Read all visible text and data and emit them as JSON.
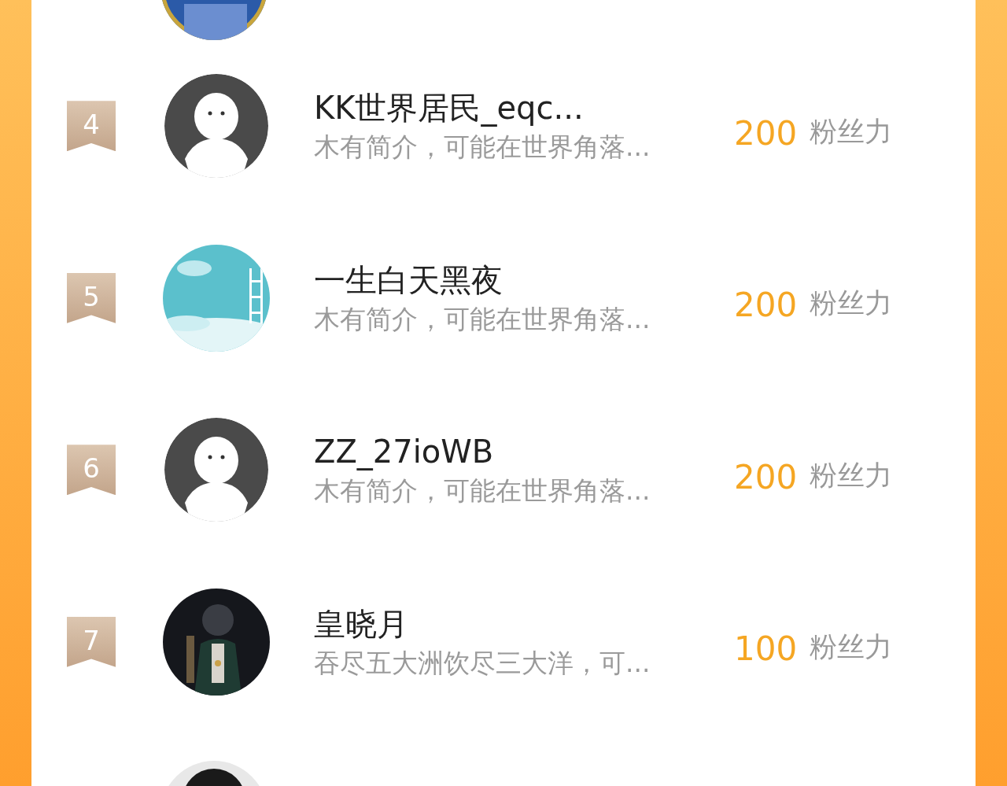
{
  "rows": [
    {
      "rank": "4",
      "avatar": {
        "kind": "default"
      },
      "name": "KK世界居民_eqc...",
      "bio": "木有简介，可能在世界角落...",
      "score": "200",
      "unit": "粉丝力"
    },
    {
      "rank": "5",
      "name": "一生白天黑夜",
      "bio": "木有简介，可能在世界角落...",
      "score": "200",
      "unit": "粉丝力"
    },
    {
      "rank": "6",
      "avatar": {
        "kind": "default"
      },
      "name": "ZZ_27ioWB",
      "bio": "木有简介，可能在世界角落...",
      "score": "200",
      "unit": "粉丝力"
    },
    {
      "rank": "7",
      "name": "皇晓月",
      "bio": "吞尽五大洲饮尽三大洋，可...",
      "score": "100",
      "unit": "粉丝力"
    }
  ]
}
